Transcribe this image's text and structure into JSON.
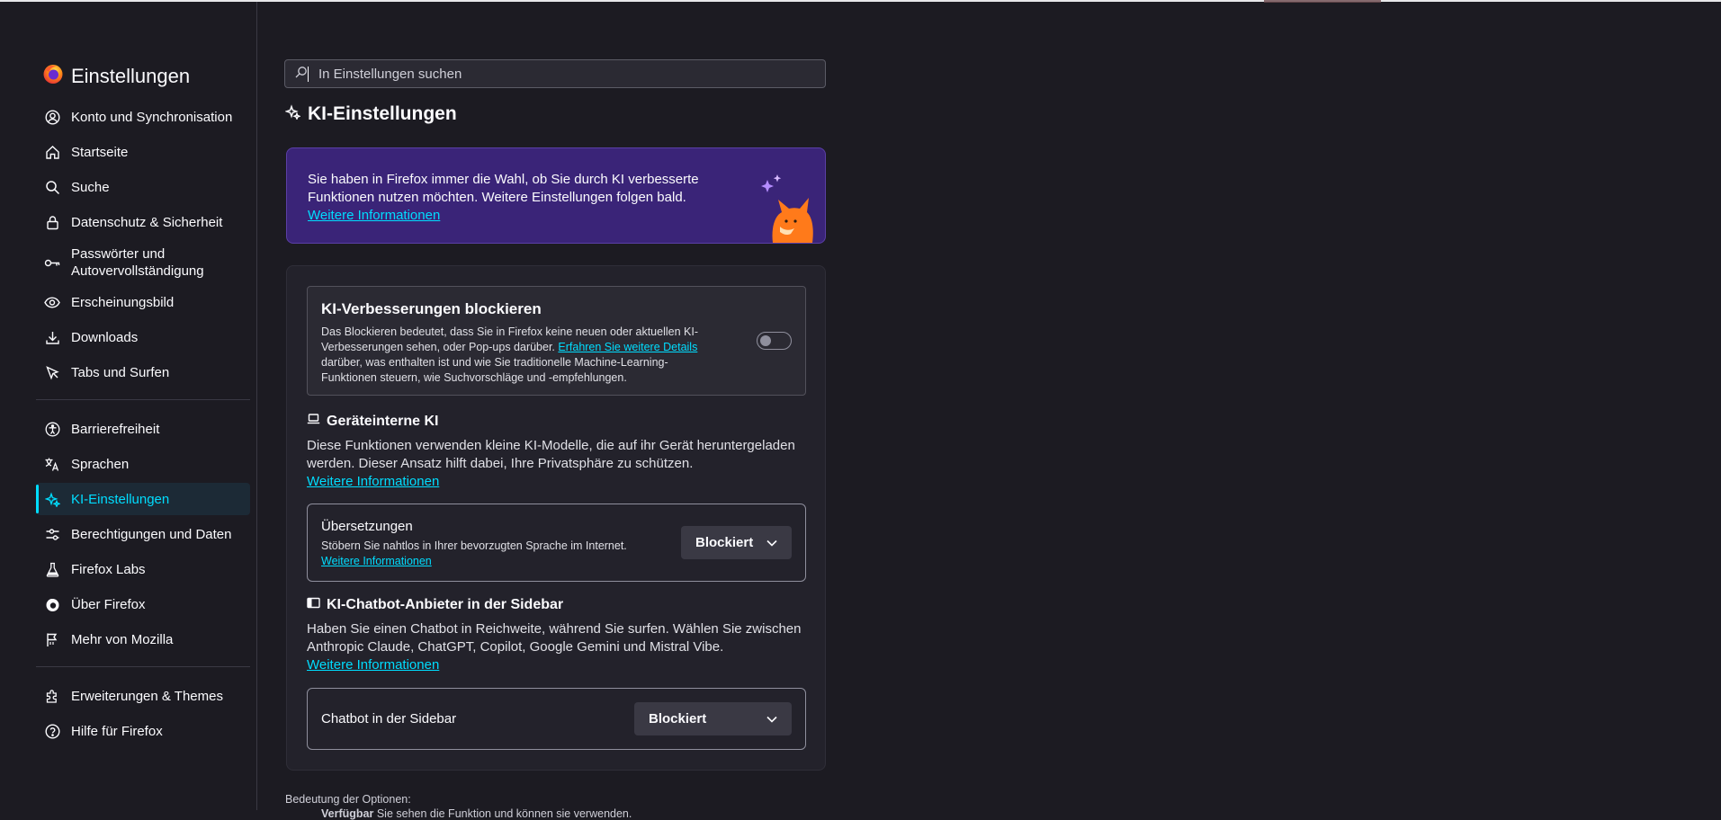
{
  "sidebar": {
    "title": "Einstellungen",
    "items": [
      {
        "label": "Konto und Synchronisation",
        "icon": "account-icon"
      },
      {
        "label": "Startseite",
        "icon": "home-icon"
      },
      {
        "label": "Suche",
        "icon": "search-icon"
      },
      {
        "label": "Datenschutz & Sicherheit",
        "icon": "lock-icon"
      },
      {
        "label": "Passwörter und Autovervollständigung",
        "icon": "key-icon"
      },
      {
        "label": "Erscheinungsbild",
        "icon": "eye-icon"
      },
      {
        "label": "Downloads",
        "icon": "download-icon"
      },
      {
        "label": "Tabs und Surfen",
        "icon": "cursor-icon"
      },
      {
        "label": "Barrierefreiheit",
        "icon": "accessibility-icon"
      },
      {
        "label": "Sprachen",
        "icon": "translate-icon"
      },
      {
        "label": "KI-Einstellungen",
        "icon": "sparkle-icon",
        "active": true
      },
      {
        "label": "Berechtigungen und Daten",
        "icon": "sliders-icon"
      },
      {
        "label": "Firefox Labs",
        "icon": "flask-icon"
      },
      {
        "label": "Über Firefox",
        "icon": "firefox-icon"
      },
      {
        "label": "Mehr von Mozilla",
        "icon": "flag-icon"
      },
      {
        "label": "Erweiterungen & Themes",
        "icon": "puzzle-icon"
      },
      {
        "label": "Hilfe für Firefox",
        "icon": "help-icon"
      }
    ]
  },
  "search": {
    "placeholder": "In Einstellungen suchen"
  },
  "page": {
    "title": "KI-Einstellungen"
  },
  "banner": {
    "text": "Sie haben in Firefox immer die Wahl, ob Sie durch KI verbesserte Funktionen nutzen möchten. Weitere Einstellungen folgen bald.",
    "link": "Weitere Informationen"
  },
  "block": {
    "title": "KI-Verbesserungen blockieren",
    "desc_before": "Das Blockieren bedeutet, dass Sie in Firefox keine neuen oder aktuellen KI-Verbesserungen sehen, oder Pop-ups darüber. ",
    "desc_link": "Erfahren Sie weitere Details",
    "desc_after": " darüber, was enthalten ist und wie Sie traditionelle Machine-Learning-Funktionen steuern, wie Suchvorschläge und -empfehlungen.",
    "toggle_on": false
  },
  "local_ai": {
    "heading": "Geräteinterne KI",
    "desc": "Diese Funktionen verwenden kleine KI-Modelle, die auf ihr Gerät heruntergeladen werden. Dieser Ansatz hilft dabei, Ihre Privatsphäre zu schützen.",
    "link": "Weitere Informationen",
    "translations": {
      "title": "Übersetzungen",
      "desc": "Stöbern Sie nahtlos in Ihrer bevorzugten Sprache im Internet.",
      "link": "Weitere Informationen",
      "value": "Blockiert"
    }
  },
  "chatbot": {
    "heading": "KI-Chatbot-Anbieter in der Sidebar",
    "desc": "Haben Sie einen Chatbot in Reichweite, während Sie surfen. Wählen Sie zwischen Anthropic Claude, ChatGPT, Copilot, Google Gemini und Mistral Vibe.",
    "link": "Weitere Informationen",
    "option": {
      "title": "Chatbot in der Sidebar",
      "value": "Blockiert"
    }
  },
  "footer": {
    "note": "Bedeutung der Optionen:",
    "note2_bold": "Verfügbar",
    "note2_rest": " Sie sehen die Funktion und können sie verwenden."
  },
  "colors": {
    "accent": "#00ddff",
    "background": "#1c1b22",
    "banner": "#3a2478"
  }
}
